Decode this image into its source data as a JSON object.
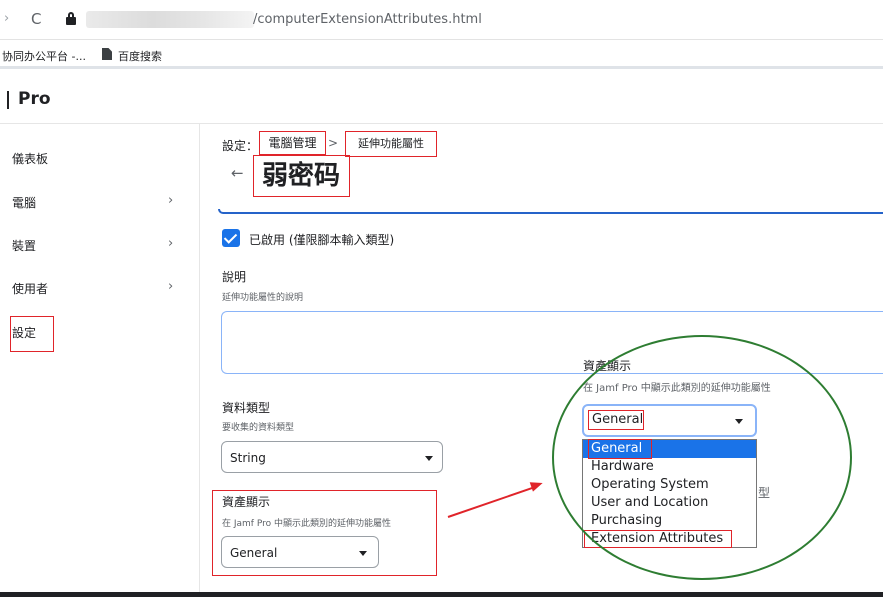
{
  "browser": {
    "forward_glyph": "›",
    "reload_glyph": "C",
    "url_suffix": "/computerExtensionAttributes.html",
    "bookmarks": [
      "协同办公平台 -...",
      "百度搜索"
    ]
  },
  "app": {
    "brand": "Pro"
  },
  "sidebar": {
    "items": [
      {
        "label": "儀表板",
        "chevron": ""
      },
      {
        "label": "電腦",
        "chevron": "›"
      },
      {
        "label": "裝置",
        "chevron": "›"
      },
      {
        "label": "使用者",
        "chevron": "›"
      },
      {
        "label": "設定",
        "chevron": ""
      }
    ]
  },
  "breadcrumb": {
    "prefix": "設定：",
    "link1": "電腦管理",
    "separator": ">",
    "link2": "延伸功能屬性"
  },
  "page": {
    "back_glyph": "←",
    "title": "弱密码"
  },
  "form": {
    "enabled": {
      "checked": true,
      "label": "已啟用 (僅限腳本輸入類型)"
    },
    "description": {
      "label": "說明",
      "help": "延伸功能屬性的說明",
      "value": ""
    },
    "data_type": {
      "label": "資料類型",
      "help": "要收集的資料類型",
      "value": "String"
    },
    "inventory_display": {
      "label": "資產顯示",
      "help": "在 Jamf Pro 中顯示此類別的延伸功能屬性",
      "value": "General"
    }
  },
  "callout": {
    "label": "資產顯示",
    "help": "在 Jamf Pro 中顯示此類別的延伸功能屬性",
    "value": "General",
    "options": [
      "General",
      "Hardware",
      "Operating System",
      "User and Location",
      "Purchasing",
      "Extension Attributes"
    ],
    "selected_index": 0,
    "background_partial": "型"
  },
  "colors": {
    "annotation_red": "#e0242a",
    "annotation_green": "#2e7d32",
    "accent_blue": "#1a73e8"
  }
}
